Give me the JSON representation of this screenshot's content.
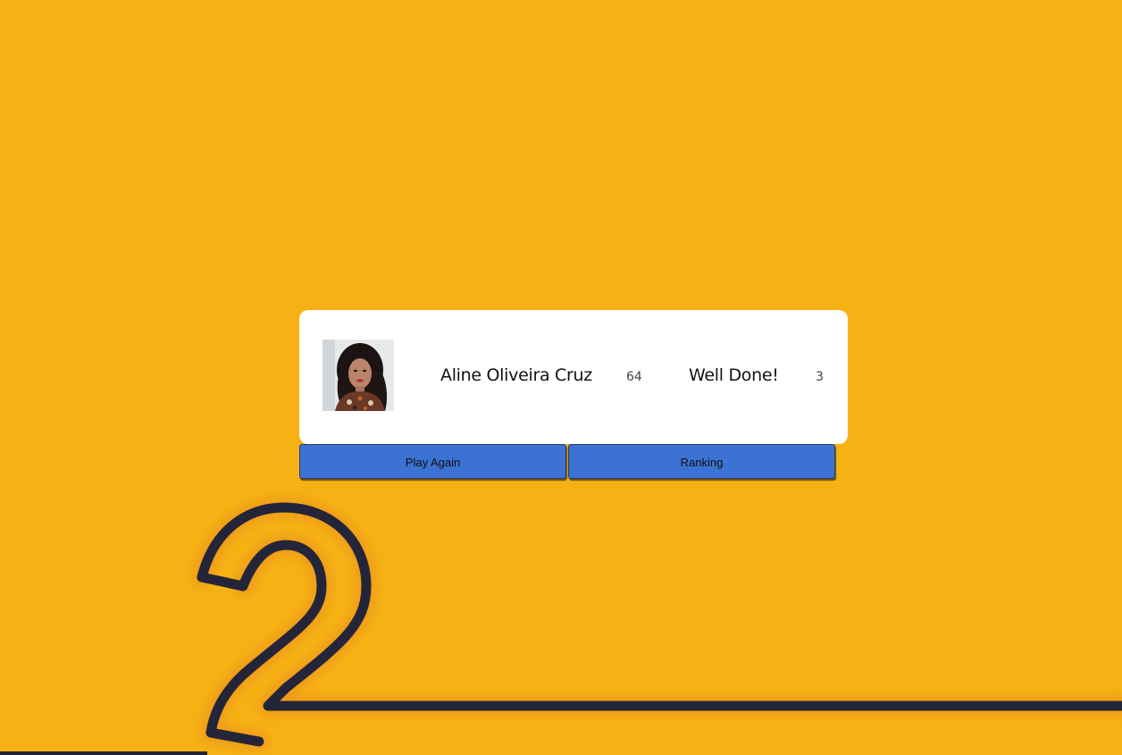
{
  "result_card": {
    "player_name": "Aline Oliveira Cruz",
    "score": "64",
    "message": "Well Done!",
    "correct_answers": "3"
  },
  "actions": {
    "play_again_label": "Play Again",
    "ranking_label": "Ranking"
  },
  "colors": {
    "background": "#f6b215",
    "button": "#3c72d3",
    "outline": "#25253a"
  },
  "decoration": {
    "glyph": "2"
  }
}
